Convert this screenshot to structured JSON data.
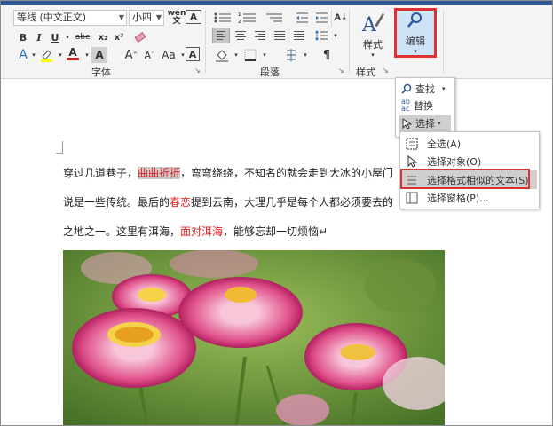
{
  "ribbon": {
    "font_name": "等线 (中文正文)",
    "font_size": "小四",
    "font_group": "字体",
    "paragraph_group": "段落",
    "styles_group": "样式",
    "styles_button": "样式",
    "edit_button": "编辑",
    "wen_glyph": "wén",
    "wen_char": "文"
  },
  "edit_menu": {
    "find": "查找",
    "replace": "替换",
    "select": "选择"
  },
  "select_menu": {
    "items": [
      "全选(A)",
      "选择对象(O)",
      "选择格式相似的文本(S)",
      "选择窗格(P)..."
    ]
  },
  "document": {
    "line1_a": "穿过几道巷子，",
    "line1_b": "曲曲折折",
    "line1_c": "，弯弯绕绕，不知名的就会走到大冰的小屋门",
    "line2_a": "说是一些传统。最后的",
    "line2_b": "春恋",
    "line2_c": "提到云南，大理几乎是每个人都必须要去的",
    "line3_a": "之地之一。这里有洱海，",
    "line3_b": "面对洱海",
    "line3_c": "，能够忘却一切烦恼↵"
  },
  "colors": {
    "accent": "#e03131",
    "highlight_text": "#e02020",
    "selection": "#c9c9c9",
    "ribbon_bg": "#f4f4f4"
  }
}
